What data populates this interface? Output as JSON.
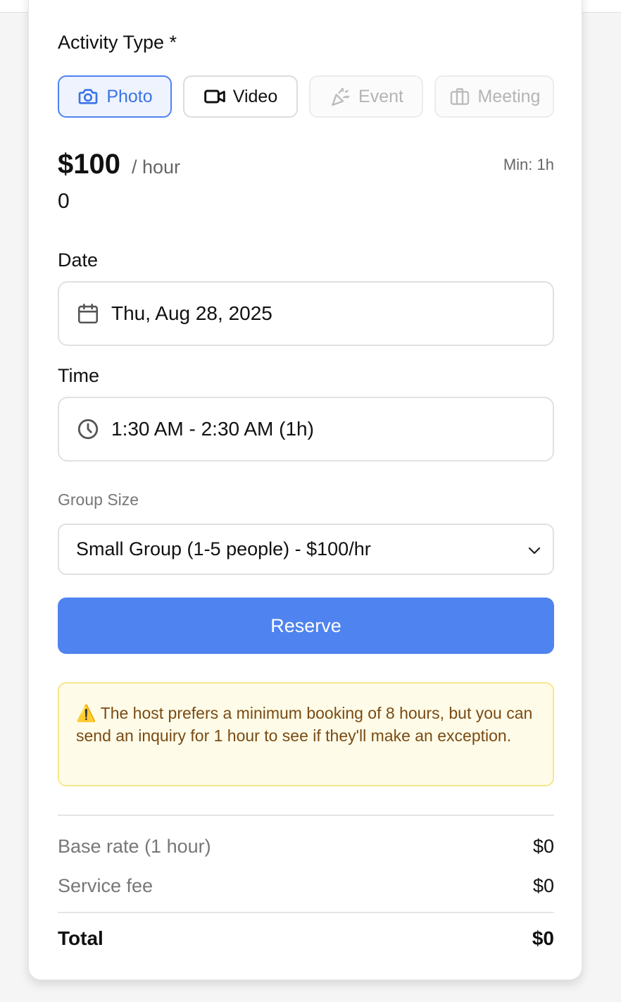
{
  "activity": {
    "label": "Activity Type *",
    "options": [
      {
        "label": "Photo",
        "icon": "camera-icon",
        "state": "selected"
      },
      {
        "label": "Video",
        "icon": "video-icon",
        "state": "enabled"
      },
      {
        "label": "Event",
        "icon": "party-popper-icon",
        "state": "disabled"
      },
      {
        "label": "Meeting",
        "icon": "briefcase-icon",
        "state": "disabled"
      }
    ]
  },
  "pricing": {
    "amount": "$100",
    "unit": "/ hour",
    "minimum": "Min: 1h",
    "extra_value": "0"
  },
  "date": {
    "label": "Date",
    "value": "Thu, Aug 28, 2025",
    "icon": "calendar-icon"
  },
  "time": {
    "label": "Time",
    "value": "1:30 AM - 2:30 AM (1h)",
    "icon": "clock-icon"
  },
  "group_size": {
    "label": "Group Size",
    "selected": "Small Group (1-5 people) - $100/hr"
  },
  "reserve_label": "Reserve",
  "notice": {
    "icon": "⚠️",
    "text": "The host prefers a minimum booking of 8 hours, but you can send an inquiry for 1 hour to see if they'll make an exception."
  },
  "summary": {
    "base_rate_label": "Base rate (1 hour)",
    "base_rate_value": "$0",
    "service_fee_label": "Service fee",
    "service_fee_value": "$0",
    "total_label": "Total",
    "total_value": "$0"
  },
  "colors": {
    "accent": "#4f83ef",
    "notice_bg": "#fefce8",
    "notice_border": "#f7e68a",
    "notice_text": "#7a4a14"
  }
}
